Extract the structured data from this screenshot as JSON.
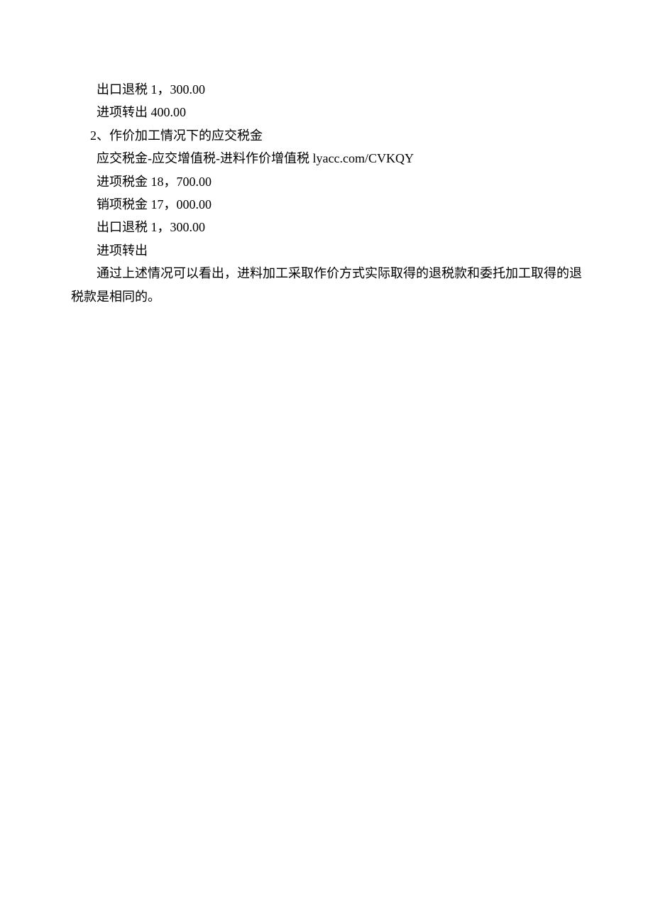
{
  "lines": {
    "l1": "出口退税 1，300.00",
    "l2": "进项转出 400.00",
    "l3": "2、作价加工情况下的应交税金",
    "l4": "应交税金-应交增值税-进料作价增值税 lyacc.com/CVKQY",
    "l5": "进项税金 18，700.00",
    "l6": "销项税金 17，000.00",
    "l7": "出口退税 1，300.00",
    "l8": "进项转出",
    "para1": "通过上述情况可以看出，进料加工采取作价方式实际取得的退税款和委托加工取得的退",
    "para1_cont": "税款是相同的。"
  }
}
